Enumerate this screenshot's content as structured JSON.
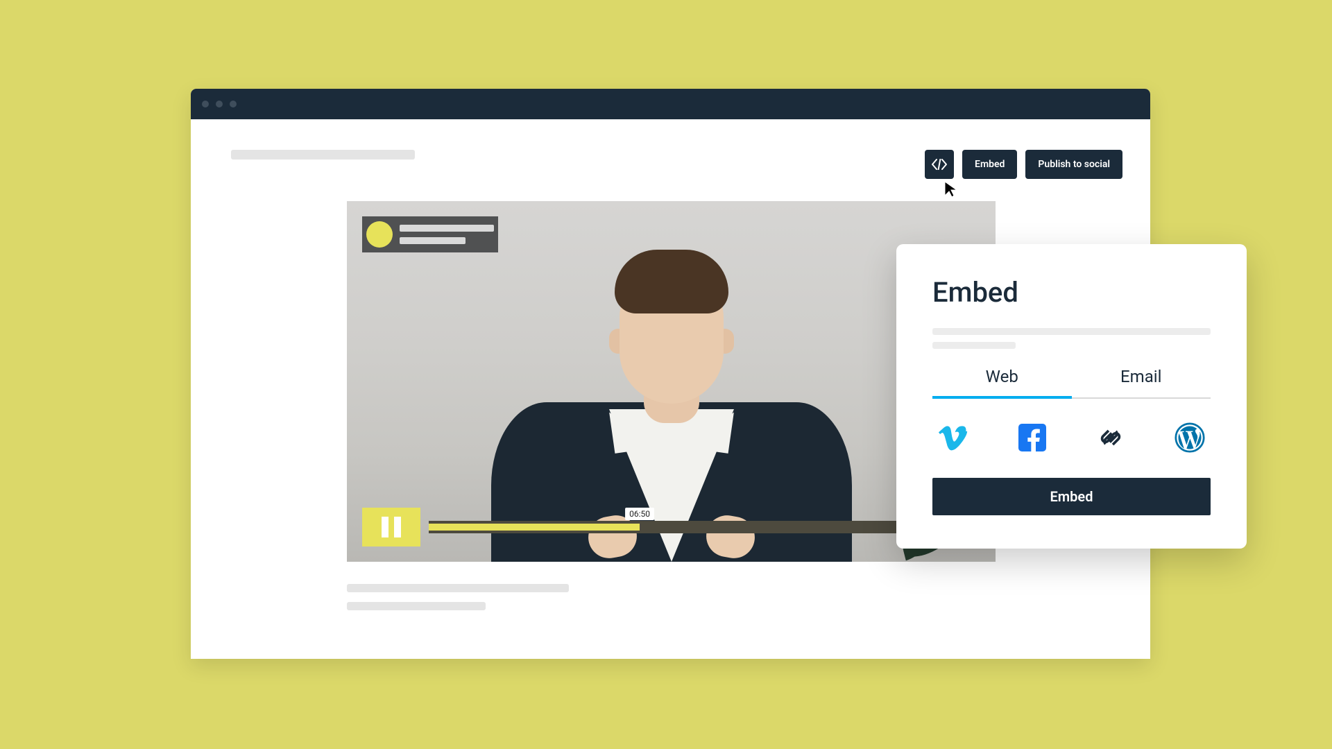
{
  "toolbar": {
    "embed_label": "Embed",
    "publish_label": "Publish to social"
  },
  "video": {
    "timestamp": "06:50"
  },
  "panel": {
    "title": "Embed",
    "tabs": {
      "web": "Web",
      "email": "Email"
    },
    "providers": {
      "vimeo": "vimeo-icon",
      "facebook": "facebook-icon",
      "squarespace": "squarespace-icon",
      "wordpress": "wordpress-icon"
    },
    "cta": "Embed"
  }
}
